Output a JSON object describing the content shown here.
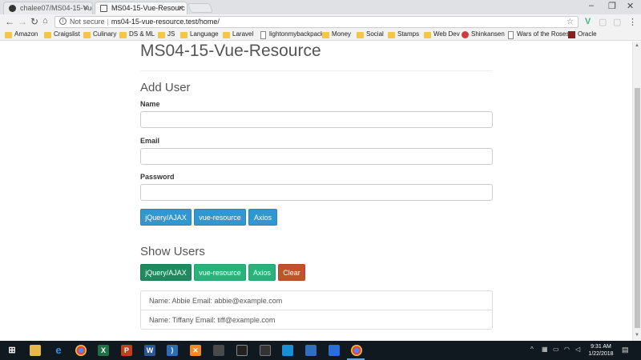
{
  "browser": {
    "tabs": [
      {
        "label": "chalee07/MS04-15-Vue",
        "active": false
      },
      {
        "label": "MS04-15-Vue-Resourc",
        "active": true
      }
    ],
    "url_security": "Not secure",
    "url": "ms04-15-vue-resource.test/home/",
    "bookmarks": [
      {
        "label": "Amazon",
        "icon": "folder-icon"
      },
      {
        "label": "Craigslist",
        "icon": "folder-icon"
      },
      {
        "label": "Culinary",
        "icon": "folder-icon"
      },
      {
        "label": "DS & ML",
        "icon": "folder-icon"
      },
      {
        "label": "JS",
        "icon": "folder-icon"
      },
      {
        "label": "Language",
        "icon": "folder-icon"
      },
      {
        "label": "Laravel",
        "icon": "folder-icon"
      },
      {
        "label": "lightonmybackpack",
        "icon": "page-icon"
      },
      {
        "label": "Money",
        "icon": "folder-icon"
      },
      {
        "label": "Social",
        "icon": "folder-icon"
      },
      {
        "label": "Stamps",
        "icon": "folder-icon"
      },
      {
        "label": "Web Dev",
        "icon": "folder-icon"
      },
      {
        "label": "Shinkansen",
        "icon": "red-dot-icon"
      },
      {
        "label": "Wars of the Roses",
        "icon": "page-icon"
      },
      {
        "label": "Oracle",
        "icon": "oracle-icon"
      }
    ]
  },
  "page": {
    "title": "MS04-15-Vue-Resource",
    "add_user": {
      "heading": "Add User",
      "name_label": "Name",
      "name_value": "",
      "email_label": "Email",
      "email_value": "",
      "password_label": "Password",
      "password_value": "",
      "buttons": [
        "jQuery/AJAX",
        "vue-resource",
        "Axios"
      ]
    },
    "show_users": {
      "heading": "Show Users",
      "buttons": [
        "jQuery/AJAX",
        "vue-resource",
        "Axios",
        "Clear"
      ],
      "users": [
        "Name: Abbie Email: abbie@example.com",
        "Name: Tiffany Email: tiff@example.com"
      ]
    }
  },
  "taskbar": {
    "clock_time": "9:31 AM",
    "clock_date": "1/22/2018"
  },
  "colors": {
    "btn_info": "#3097d1",
    "btn_success": "#2ab27b",
    "btn_danger": "#bf5329"
  }
}
